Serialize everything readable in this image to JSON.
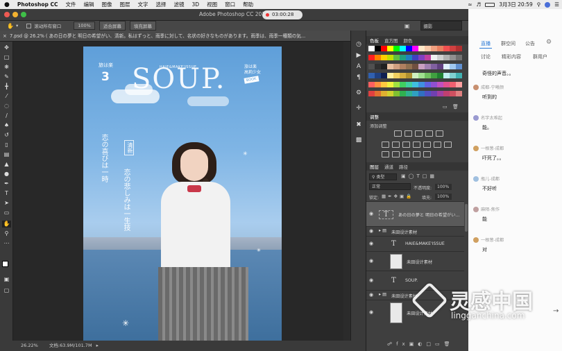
{
  "menubar": {
    "apple": "",
    "app": "Photoshop CC",
    "items": [
      "文件",
      "编辑",
      "图像",
      "图层",
      "文字",
      "选择",
      "滤镜",
      "3D",
      "视图",
      "窗口",
      "帮助"
    ],
    "clock": "3月3日 20:59"
  },
  "window": {
    "title": "Adobe Photoshop CC 201",
    "timer": "03:00:28"
  },
  "options": {
    "scroll_all": "滚动所有窗口",
    "zoom": "100%",
    "fit_screen": "适合屏幕",
    "fill_screen": "填充屏幕",
    "workspace": "摄影"
  },
  "document": {
    "tab_label": "7.psd @ 26.2% (  あの日の夢と 明日の希望がい、清新。私はずっと、雨季に対して、名状の好きなものがあります。雨季は、雨季一種類の気..."
  },
  "status": {
    "zoom": "26.22%",
    "doc_size": "文档:63.9M/101.7M"
  },
  "artwork": {
    "brand": "SOUP.",
    "brand_sub": "HAIE&MAKE'ISSUE",
    "issue_label": "旅は楽",
    "issue_num": "3",
    "badge_lines": [
      "旅は楽",
      "高莉少女"
    ],
    "badge_tag": "BOOK",
    "vertical_1": "恋の悲しみは一生技",
    "vertical_2": "恋の喜びは一時",
    "vertical_box": "清新"
  },
  "colors": {
    "accent": "#2a7ad6",
    "panel_bg": "#3f3f3f",
    "chat_bg": "#fbfbfb",
    "sky_top": "#5f9fd9"
  },
  "swatches_panel": {
    "tabs": [
      "色板",
      "直方图",
      "颜色"
    ]
  },
  "adjustments_panel": {
    "title": "调整",
    "add_label": "添加调整"
  },
  "layers_panel": {
    "tabs": [
      "图层",
      "通道",
      "路径"
    ],
    "filter": "类型",
    "blend_mode": "正常",
    "opacity_label": "不透明度:",
    "opacity": "100%",
    "lock_label": "锁定:",
    "fill_label": "填充:",
    "fill": "100%",
    "layers": [
      {
        "name": "あの日の夢と 明日の希望がい...",
        "kind": "text"
      },
      {
        "name": "未田设计素材",
        "kind": "group"
      },
      {
        "name": "HAIE&MAKE'ISSUE",
        "kind": "text"
      },
      {
        "name": "未田设计素材",
        "kind": "image"
      },
      {
        "name": "SOUP.",
        "kind": "text"
      },
      {
        "name": "未田设计素材",
        "kind": "group"
      },
      {
        "name": "未田设计素材",
        "kind": "image"
      }
    ]
  },
  "chat": {
    "tabs": [
      "直播",
      "群空间",
      "公告"
    ],
    "subtabs": [
      "讨论",
      "精彩内容",
      "群用户"
    ],
    "messages": [
      {
        "user": "",
        "text": "奇怪的声音。。"
      },
      {
        "user": "成都-宁曦颜",
        "text": "听到的"
      },
      {
        "user": "名字太难起",
        "text": "能。"
      },
      {
        "user": "一根葱-成都",
        "text": "吓死了。。"
      },
      {
        "user": "瓶儿-成都",
        "text": "不好听"
      },
      {
        "user": "麻陌-焦作",
        "text": "能"
      },
      {
        "user": "一根葱-成都",
        "text": "对"
      }
    ]
  },
  "watermark": {
    "brand": "灵感中国",
    "url": "lingganchina.com"
  }
}
